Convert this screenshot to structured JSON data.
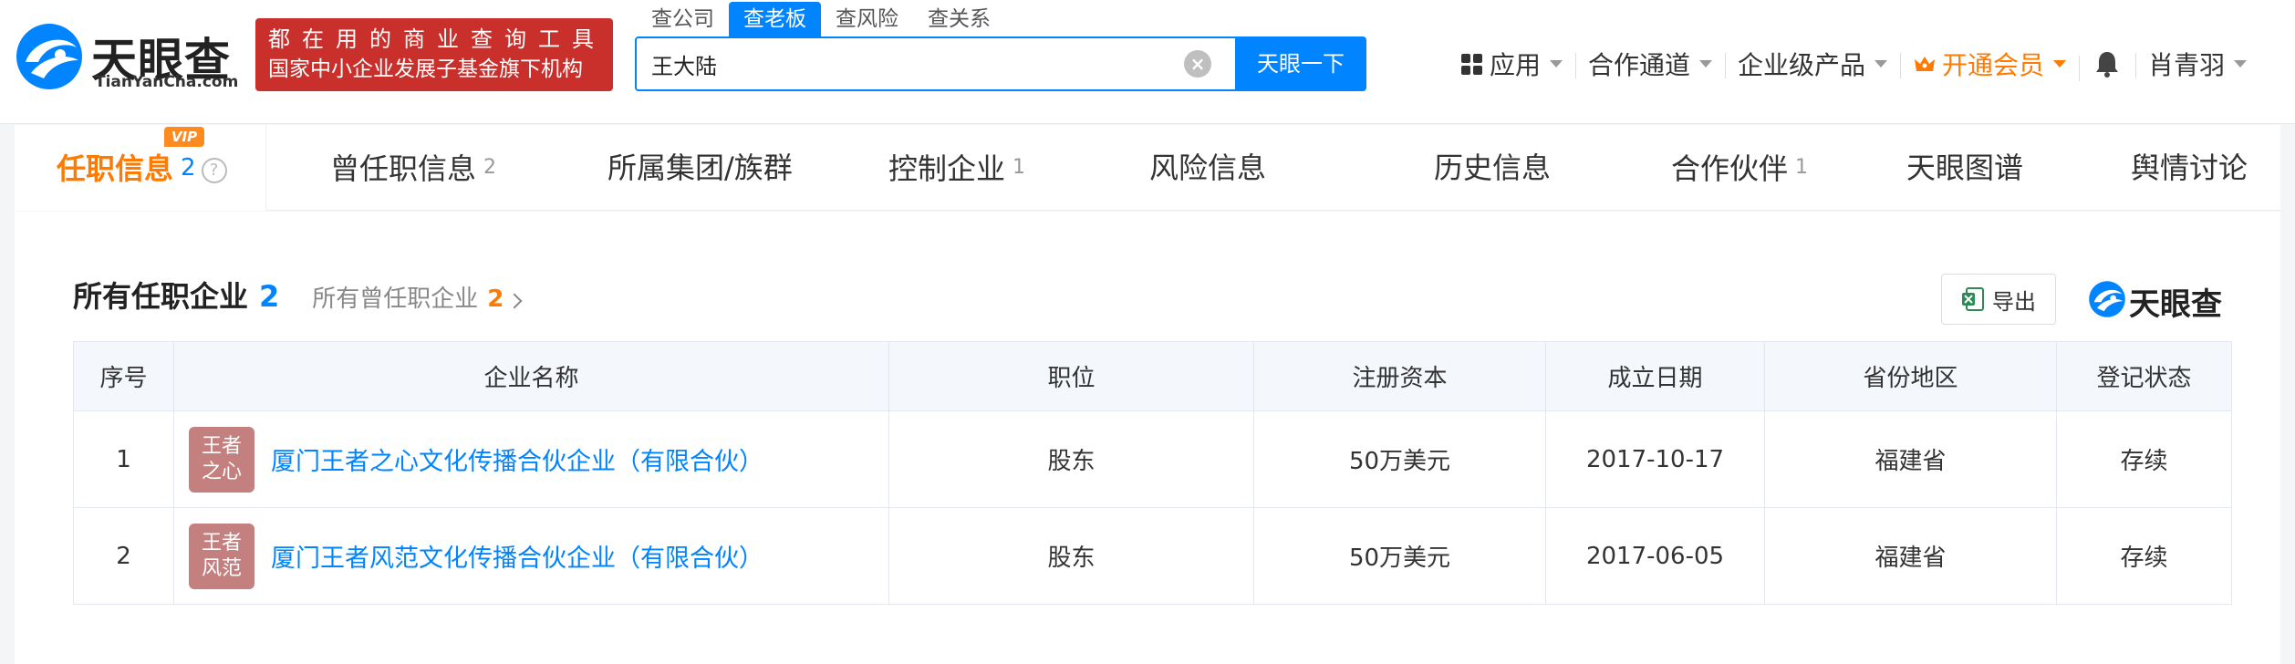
{
  "header": {
    "logo_cn": "天眼查",
    "logo_en": "TianYanCha.com",
    "slogan_line1": "都在用的商业查询工具",
    "slogan_line2": "国家中小企业发展子基金旗下机构",
    "search_tabs": [
      "查公司",
      "查老板",
      "查风险",
      "查关系"
    ],
    "active_search_tab": "查老板",
    "search_value": "王大陆",
    "search_button": "天眼一下",
    "nav": {
      "apps": "应用",
      "channels": "合作通道",
      "enterprise": "企业级产品",
      "vip": "开通会员",
      "user": "肖青羽"
    }
  },
  "tabs": {
    "vip_badge": "VIP",
    "items": [
      {
        "label": "任职信息",
        "count": "2"
      },
      {
        "label": "曾任职信息",
        "count": "2"
      },
      {
        "label": "所属集团/族群",
        "count": ""
      },
      {
        "label": "控制企业",
        "count": "1"
      },
      {
        "label": "风险信息",
        "count": ""
      },
      {
        "label": "历史信息",
        "count": ""
      },
      {
        "label": "合作伙伴",
        "count": "1"
      },
      {
        "label": "天眼图谱",
        "count": ""
      },
      {
        "label": "舆情讨论",
        "count": ""
      }
    ]
  },
  "section": {
    "title": "所有任职企业",
    "count": "2",
    "sub_label": "所有曾任职企业",
    "sub_count": "2",
    "export_label": "导出",
    "brand": "天眼查"
  },
  "table": {
    "headers": [
      "序号",
      "企业名称",
      "职位",
      "注册资本",
      "成立日期",
      "省份地区",
      "登记状态"
    ],
    "rows": [
      {
        "index": "1",
        "avatar_line1": "王者",
        "avatar_line2": "之心",
        "name": "厦门王者之心文化传播合伙企业（有限合伙）",
        "position": "股东",
        "capital": "50万美元",
        "date": "2017-10-17",
        "region": "福建省",
        "status": "存续"
      },
      {
        "index": "2",
        "avatar_line1": "王者",
        "avatar_line2": "风范",
        "name": "厦门王者风范文化传播合伙企业（有限合伙）",
        "position": "股东",
        "capital": "50万美元",
        "date": "2017-06-05",
        "region": "福建省",
        "status": "存续"
      }
    ]
  },
  "colors": {
    "brand_blue": "#0084ff",
    "vip_orange": "#ff7a00",
    "slogan_red": "#c9302c",
    "status_green": "#3a9a3a",
    "avatar_rose": "#c47f7f"
  },
  "icons": [
    "tianyancha-logo-icon",
    "clear-icon",
    "apps-grid-icon",
    "crown-icon",
    "bell-icon",
    "help-icon",
    "excel-icon",
    "chevron-right-icon"
  ]
}
